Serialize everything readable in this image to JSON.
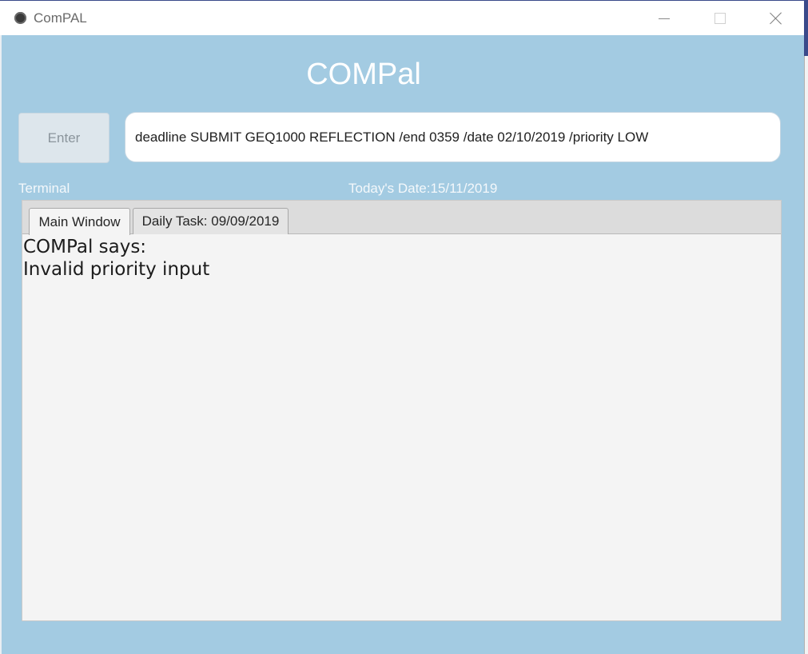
{
  "window": {
    "title": "ComPAL",
    "icon": "app-logo-icon",
    "controls": [
      "minimize-icon",
      "maximize-icon",
      "close-icon"
    ]
  },
  "app": {
    "heading": "COMPal"
  },
  "command_bar": {
    "enter_label": "Enter",
    "input_value": "deadline SUBMIT GEQ1000 REFLECTION /end 0359 /date 02/10/2019 /priority LOW"
  },
  "status": {
    "terminal_label": "Terminal",
    "today_date": "Today's Date:15/11/2019"
  },
  "tabs": [
    {
      "label": "Main Window",
      "selected": true
    },
    {
      "label": "Daily Task: 09/09/2019",
      "selected": false
    }
  ],
  "output": {
    "lines": [
      "COMPal says:",
      "Invalid priority input"
    ]
  },
  "colors": {
    "background": "#a3cbe2",
    "heading_text": "#ffffff",
    "panel": "#f4f4f4"
  }
}
